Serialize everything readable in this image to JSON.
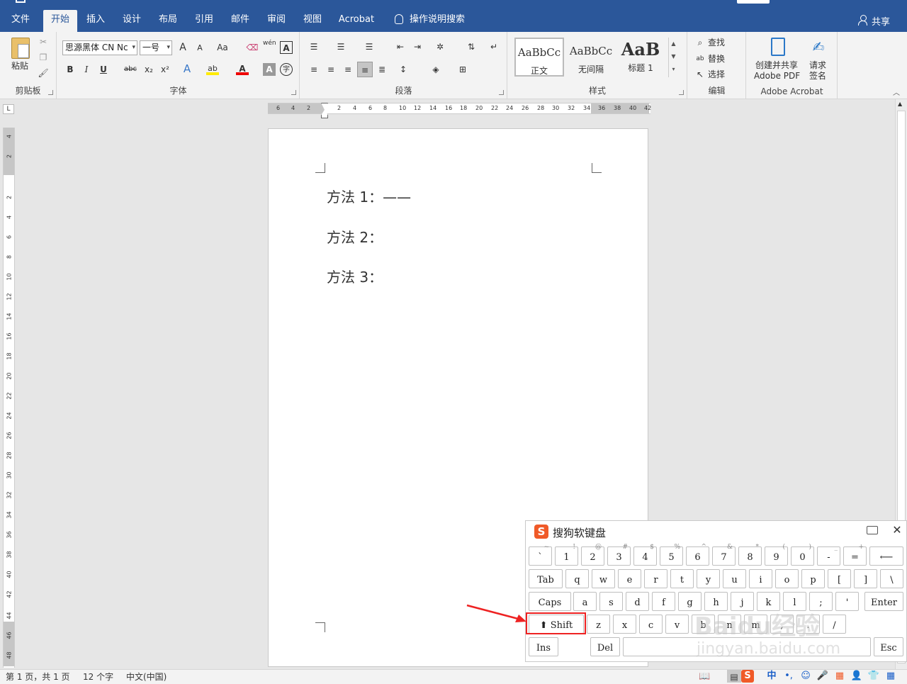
{
  "tabs": [
    {
      "label": "文件",
      "active": false
    },
    {
      "label": "开始",
      "active": true
    },
    {
      "label": "插入",
      "active": false
    },
    {
      "label": "设计",
      "active": false
    },
    {
      "label": "布局",
      "active": false
    },
    {
      "label": "引用",
      "active": false
    },
    {
      "label": "邮件",
      "active": false
    },
    {
      "label": "审阅",
      "active": false
    },
    {
      "label": "视图",
      "active": false
    },
    {
      "label": "Acrobat",
      "active": false
    }
  ],
  "tell_me": "操作说明搜索",
  "share": "共享",
  "ribbon": {
    "clipboard": {
      "paste": "粘贴",
      "label": "剪贴板"
    },
    "font": {
      "name": "思源黑体 CN Nc",
      "size": "一号",
      "label": "字体",
      "change_case": "Aa",
      "bold": "B",
      "italic": "I",
      "underline": "U",
      "strike": "abc",
      "sub": "x₂",
      "sup": "x²",
      "grow": "A",
      "shrink": "A",
      "phonetic": "wén",
      "border_char": "A"
    },
    "paragraph": {
      "label": "段落"
    },
    "styles": {
      "label": "样式",
      "items": [
        {
          "sample": "AaBbCc",
          "name": "正文"
        },
        {
          "sample": "AaBbCc",
          "name": "无间隔"
        },
        {
          "sample": "AaB",
          "name": "标题 1"
        }
      ]
    },
    "editing": {
      "find": "查找",
      "replace": "替换",
      "select": "选择",
      "label": "编辑"
    },
    "acrobat": {
      "create": "创建并共享",
      "create2": "Adobe PDF",
      "request": "请求",
      "request2": "签名",
      "label": "Adobe Acrobat"
    }
  },
  "ruler": {
    "corner": "L",
    "h_ticks": [
      "6",
      "4",
      "2",
      "2",
      "4",
      "6",
      "8",
      "10",
      "12",
      "14",
      "16",
      "18",
      "20",
      "22",
      "24",
      "26",
      "28",
      "30",
      "32",
      "34",
      "36",
      "38",
      "40",
      "42"
    ],
    "v_ticks": [
      "4",
      "2",
      "2",
      "4",
      "6",
      "8",
      "10",
      "12",
      "14",
      "16",
      "18",
      "20",
      "22",
      "24",
      "26",
      "28",
      "30",
      "32",
      "34",
      "36",
      "38",
      "40",
      "42",
      "44",
      "46",
      "48"
    ]
  },
  "document": {
    "lines": [
      "方法 1：——",
      "方法 2：",
      "方法 3："
    ]
  },
  "status": {
    "page": "第 1 页，共 1 页",
    "words": "12 个字",
    "lang": "中文(中国)"
  },
  "keyboard": {
    "title": "搜狗软键盘",
    "row1": [
      {
        "k": "`",
        "s": "~"
      },
      {
        "k": "1",
        "s": "!"
      },
      {
        "k": "2",
        "s": "@"
      },
      {
        "k": "3",
        "s": "#"
      },
      {
        "k": "4",
        "s": "$"
      },
      {
        "k": "5",
        "s": "%"
      },
      {
        "k": "6",
        "s": "^"
      },
      {
        "k": "7",
        "s": "&"
      },
      {
        "k": "8",
        "s": "*"
      },
      {
        "k": "9",
        "s": "("
      },
      {
        "k": "0",
        "s": ")"
      },
      {
        "k": "-",
        "s": "_"
      },
      {
        "k": "=",
        "s": "+"
      }
    ],
    "row2": [
      "q",
      "w",
      "e",
      "r",
      "t",
      "y",
      "u",
      "i",
      "o",
      "p",
      "[",
      "]",
      "\\"
    ],
    "row3": [
      "a",
      "s",
      "d",
      "f",
      "g",
      "h",
      "j",
      "k",
      "l",
      ";",
      "'"
    ],
    "row4": [
      "z",
      "x",
      "c",
      "v",
      "b",
      "n",
      "m",
      ",",
      ".",
      "/"
    ],
    "tab": "Tab",
    "caps": "Caps",
    "enter": "Enter",
    "shift": "Shift",
    "ins": "Ins",
    "del": "Del",
    "esc": "Esc",
    "backspace": "⟵"
  },
  "tray": {
    "ime": "中",
    "dot": "•,"
  },
  "watermark": {
    "main": "Baidu经验",
    "sub": "jingyan.baidu.com"
  },
  "colors": {
    "accent": "#2b579a",
    "highlight": "#e22222",
    "sogou": "#f05a28"
  }
}
